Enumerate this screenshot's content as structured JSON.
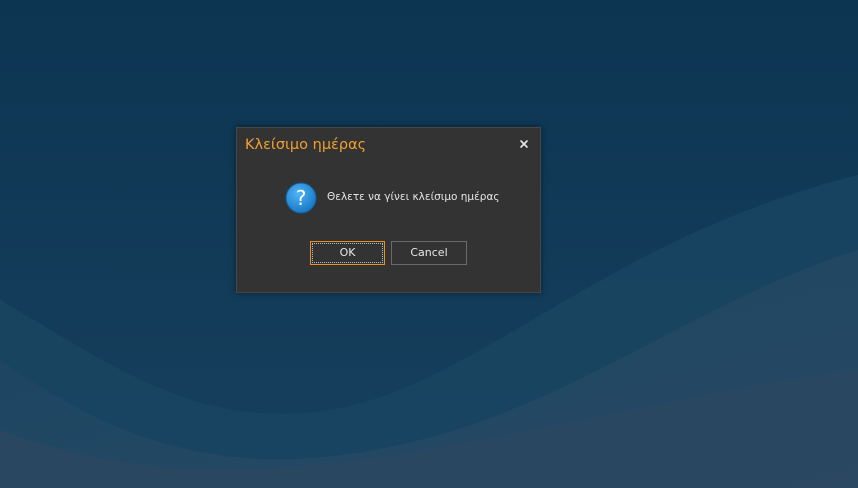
{
  "dialog": {
    "title": "Κλείσιμο ημέρας",
    "message": "Θελετε να γίνει κλείσιμο ημέρας",
    "ok_label": "OK",
    "cancel_label": "Cancel",
    "icon": "question-icon",
    "close_icon": "close-icon"
  },
  "colors": {
    "background": "#0f3a5a",
    "dialog_bg": "#333333",
    "title": "#f0a030",
    "focus_border": "#e8922a",
    "icon_blue": "#1d8ad8"
  }
}
